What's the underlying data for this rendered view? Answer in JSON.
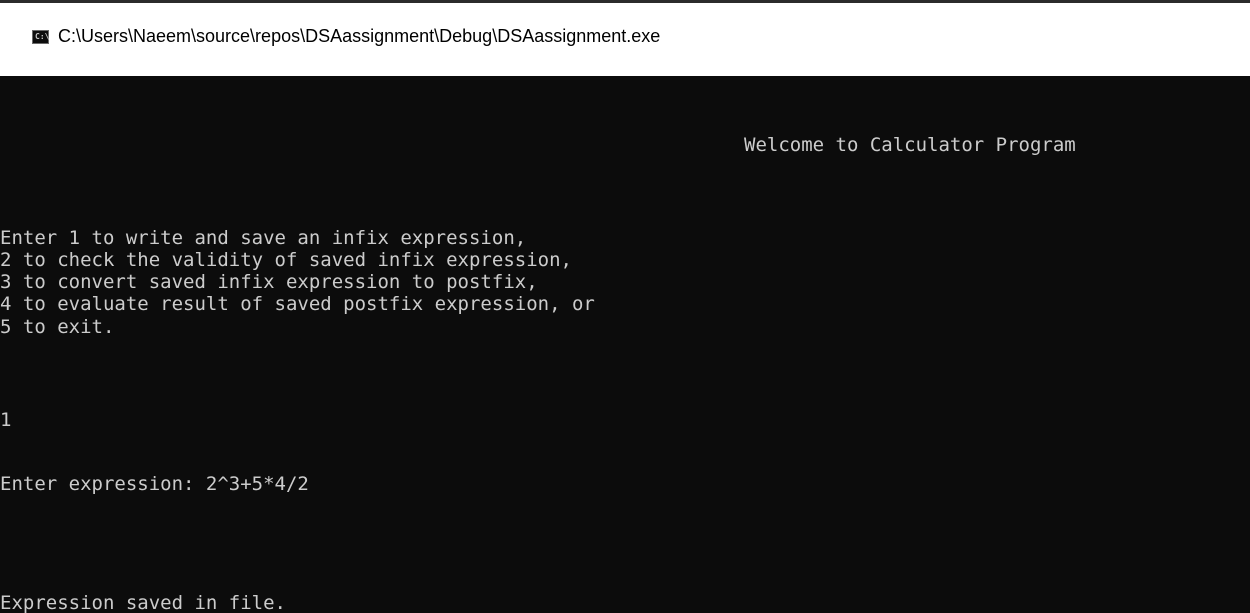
{
  "window": {
    "title": "C:\\Users\\Naeem\\source\\repos\\DSAassignment\\Debug\\DSAassignment.exe",
    "icon": "console-app-icon",
    "icon_glyph": "C:\\"
  },
  "console": {
    "welcome": "Welcome to Calculator Program",
    "menu": [
      "Enter 1 to write and save an infix expression,",
      "2 to check the validity of saved infix expression,",
      "3 to convert saved infix expression to postfix,",
      "4 to evaluate result of saved postfix expression, or",
      "5 to exit."
    ],
    "user_choice": "1",
    "prompt": "Enter expression: 2^3+5*4/2",
    "status": "Expression saved in file."
  },
  "colors": {
    "background": "#0c0c0c",
    "text": "#cccccc",
    "titlebar": "#ffffff"
  }
}
